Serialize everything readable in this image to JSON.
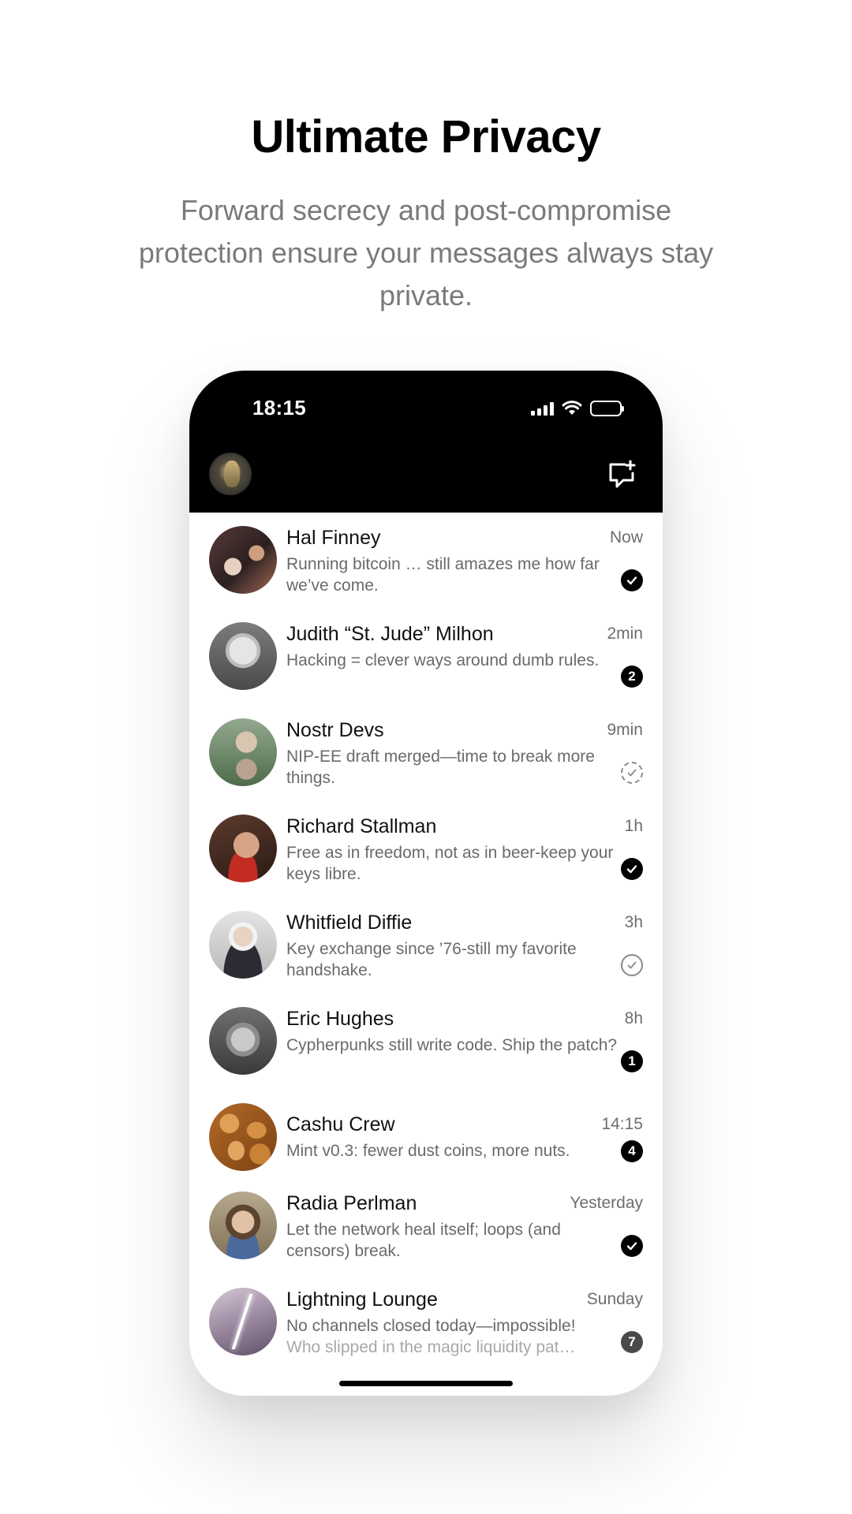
{
  "promo": {
    "title": "Ultimate Privacy",
    "subtitle": "Forward secrecy and post-compromise protection ensure your messages always stay private."
  },
  "status_bar": {
    "time": "18:15",
    "icons": [
      "signal-icon",
      "wifi-icon",
      "battery-icon"
    ]
  },
  "header": {
    "profile_icon": "avatar",
    "compose_icon": "new-chat-icon"
  },
  "chats": [
    {
      "name": "Hal Finney",
      "time": "Now",
      "preview": "Running bitcoin … still amazes me how far we’ve come.",
      "status": "read",
      "count": ""
    },
    {
      "name": "Judith “St. Jude” Milhon",
      "time": "2min",
      "preview": "Hacking = clever ways around dumb rules.",
      "status": "unread",
      "count": "2"
    },
    {
      "name": "Nostr Devs",
      "time": "9min",
      "preview": "NIP-EE draft merged—time to break more things.",
      "status": "pending",
      "count": ""
    },
    {
      "name": "Richard Stallman",
      "time": "1h",
      "preview": "Free as in freedom, not as in beer-keep your keys libre.",
      "status": "read",
      "count": ""
    },
    {
      "name": "Whitfield Diffie",
      "time": "3h",
      "preview": "Key exchange since ’76-still my favorite handshake.",
      "status": "sent",
      "count": ""
    },
    {
      "name": "Eric Hughes",
      "time": "8h",
      "preview": "Cypherpunks still write code. Ship the patch?",
      "status": "unread",
      "count": "1"
    },
    {
      "name": "Cashu Crew",
      "time": "14:15",
      "preview": "Mint v0.3: fewer dust coins, more nuts.",
      "status": "unread",
      "count": "4"
    },
    {
      "name": "Radia Perlman",
      "time": "Yesterday",
      "preview": "Let the network heal itself; loops (and censors) break.",
      "status": "read",
      "count": ""
    },
    {
      "name": "Lightning Lounge",
      "time": "Sunday",
      "preview_line1": "No channels closed today—impossible!",
      "preview_line2": "Who slipped in the magic liquidity pat…",
      "status": "unread",
      "count": "7"
    }
  ],
  "colors": {
    "header_bg": "#000000",
    "badge": "#000000",
    "muted_text": "#6a6a6a"
  }
}
